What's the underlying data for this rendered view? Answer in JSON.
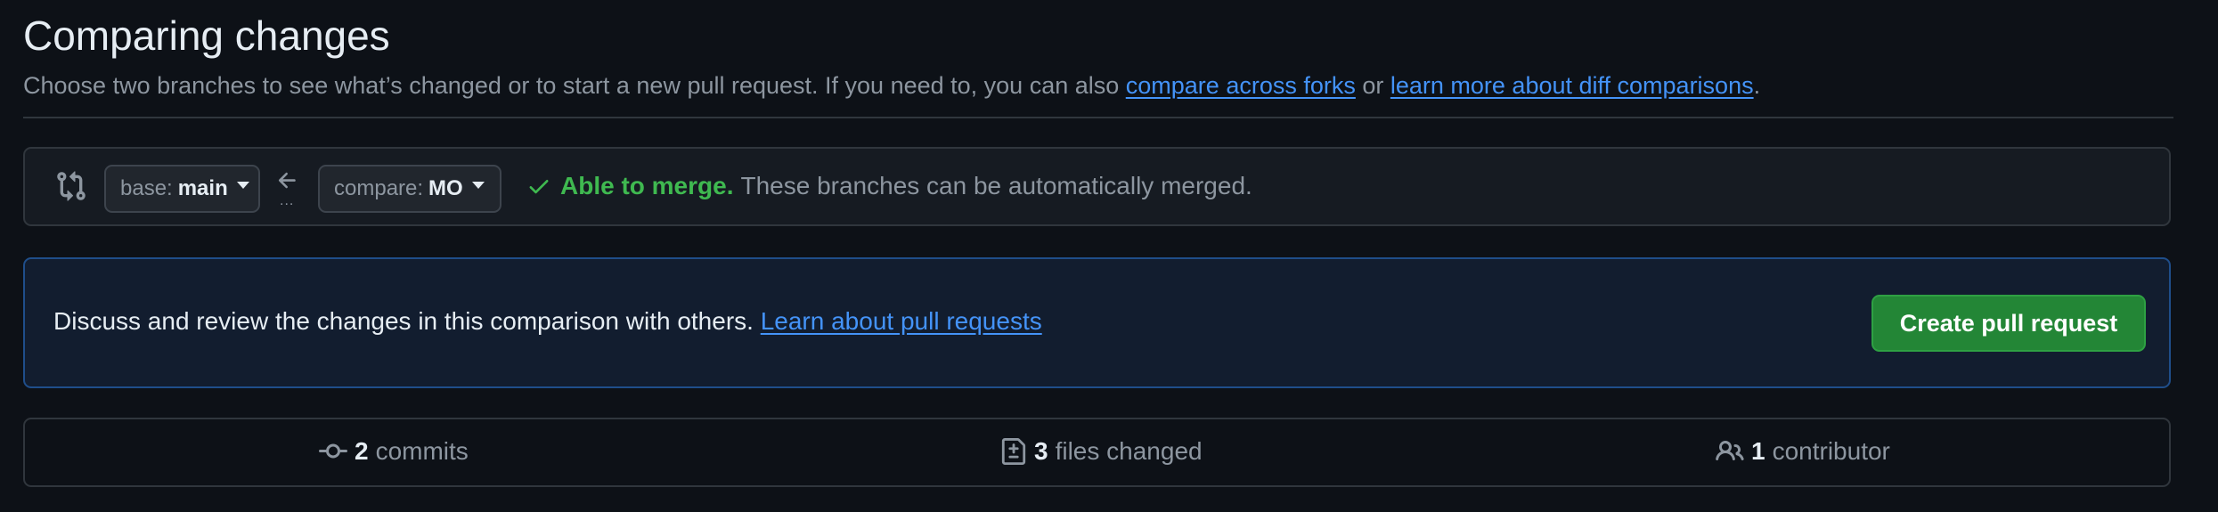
{
  "header": {
    "title": "Comparing changes",
    "subtitle_before": "Choose two branches to see what’s changed or to start a new pull request. If you need to, you can also ",
    "link_forks": "compare across forks",
    "subtitle_or": " or ",
    "link_diff": "learn more about diff comparisons",
    "subtitle_end": "."
  },
  "range": {
    "base_prefix": "base:",
    "base_branch": "main",
    "compare_prefix": "compare:",
    "compare_branch": "MO",
    "dots": "...",
    "merge_status": "Able to merge.",
    "merge_description": "These branches can be automatically merged."
  },
  "discuss": {
    "text": "Discuss and review the changes in this comparison with others. ",
    "link": "Learn about pull requests",
    "button": "Create pull request"
  },
  "stats": {
    "commits_count": "2",
    "commits_label": "commits",
    "files_count": "3",
    "files_label": "files changed",
    "contributors_count": "1",
    "contributors_label": "contributor"
  },
  "icons": {
    "range": "git-compare-icon",
    "arrow": "arrow-left-icon",
    "check": "check-icon",
    "commits": "git-commit-icon",
    "files": "file-diff-icon",
    "contributors": "people-icon"
  },
  "colors": {
    "background": "#0d1117",
    "accent_link": "#4493f8",
    "success": "#3fb950",
    "button_green": "#238636",
    "muted_text": "#8d96a0"
  }
}
